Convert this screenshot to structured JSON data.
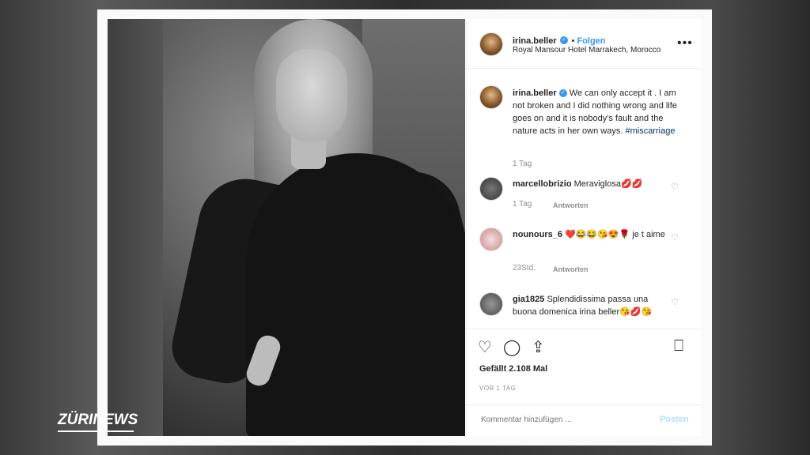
{
  "post": {
    "username": "irina.beller",
    "verified_mark": "✓",
    "follow_label": "Folgen",
    "location": "Royal Mansour Hotel Marrakech, Morocco",
    "more_label": "•••",
    "caption_user": "irina.beller",
    "caption_text": "We can only accept it . I am not broken and I did nothing wrong and life goes on and it is nobody's fault and the nature acts in her own ways.",
    "caption_tag": "#miscarriage",
    "caption_time": "1 Tag"
  },
  "comments": [
    {
      "user": "marcellobrizio",
      "text": "Meraviglosa💋💋",
      "time": "1 Tag",
      "reply": "Antworten"
    },
    {
      "user": "nounours_6",
      "text": "❤️😂😂😘😍🌹 je t aime",
      "time": "23Std.",
      "reply": "Antworten"
    },
    {
      "user": "gia1825",
      "text": "Splendidissima passa una buona domenica irina beller😘💋😘",
      "time": "",
      "reply": ""
    }
  ],
  "actions": {
    "like_icon": "heart-outline-icon",
    "comment_icon": "comment-icon",
    "share_icon": "share-icon",
    "save_icon": "bookmark-icon",
    "likes_text": "Gefällt 2.108 Mal",
    "ago_text": "VOR 1 TAG"
  },
  "comment_box": {
    "placeholder": "Kommentar hinzufügen ...",
    "post_label": "Posten"
  },
  "overlay": {
    "logo": "ZÜRINEWS"
  }
}
